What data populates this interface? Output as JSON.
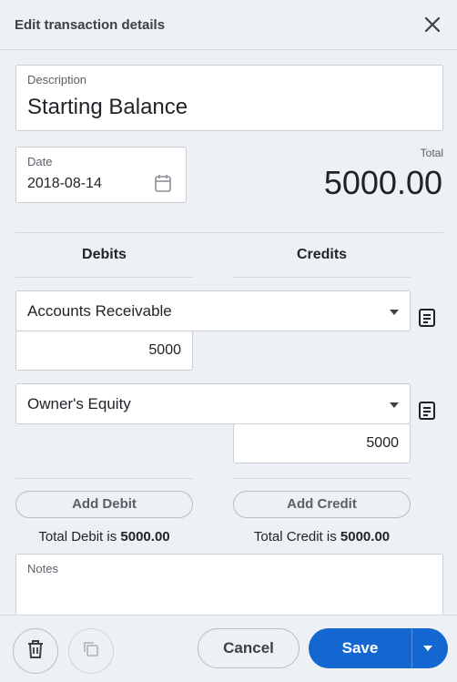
{
  "header": {
    "title": "Edit transaction details"
  },
  "description": {
    "label": "Description",
    "value": "Starting Balance"
  },
  "date": {
    "label": "Date",
    "value": "2018-08-14"
  },
  "total": {
    "label": "Total",
    "value": "5000.00"
  },
  "columns": {
    "debits": "Debits",
    "credits": "Credits"
  },
  "lines": [
    {
      "account": "Accounts Receivable",
      "debit": "5000",
      "credit": ""
    },
    {
      "account": "Owner's Equity",
      "debit": "",
      "credit": "5000"
    }
  ],
  "actions": {
    "add_debit": "Add Debit",
    "add_credit": "Add Credit"
  },
  "totals": {
    "debit_prefix": "Total Debit is ",
    "debit_value": "5000.00",
    "credit_prefix": "Total Credit is ",
    "credit_value": "5000.00"
  },
  "notes": {
    "label": "Notes",
    "value": ""
  },
  "footer": {
    "cancel": "Cancel",
    "save": "Save"
  },
  "colors": {
    "primary": "#1467d1",
    "background": "#edf0f4"
  }
}
